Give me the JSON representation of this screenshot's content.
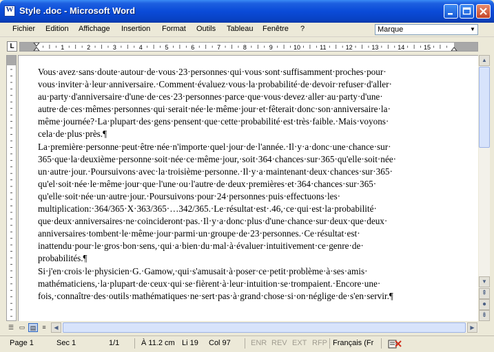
{
  "window": {
    "title": "Style .doc - Microsoft Word",
    "app_icon": "word-doc-icon"
  },
  "menu": [
    "Fichier",
    "Edition",
    "Affichage",
    "Insertion",
    "Format",
    "Outils",
    "Tableau",
    "Fenêtre",
    "?"
  ],
  "style_box": {
    "value": "Marque"
  },
  "ruler": {
    "tab_selector": "L",
    "numbers": [
      "1",
      "2",
      "3",
      "4",
      "5",
      "6",
      "7",
      "8",
      "9",
      "10",
      "11",
      "12",
      "13",
      "14",
      "15"
    ]
  },
  "document": {
    "paragraphs": [
      [
        "Vous·avez·sans·doute·autour·de·vous·23·personnes·qui·vous·sont·suffisamment·proches·pour·",
        "vous·inviter·à·leur·anniversaire.·Comment·évaluez·vous·la·probabilité·de·devoir·refuser·d'aller·",
        "au·party·d'anniversaire·d'une·de·ces·23·personnes·parce·que·vous·devez·aller·au·party·d'une·",
        "autre·de·ces·mêmes·personnes·qui·serait·née·le·même·jour·et·fêterait·donc·son·anniversaire·la·",
        "même·journée?·La·plupart·des·gens·pensent·que·cette·probabilité·est·très·faible.·Mais·voyons·",
        "cela·de·plus·près.¶"
      ],
      [
        "La·première·personne·peut·être·née·n'importe·quel·jour·de·l'année.·Il·y·a·donc·une·chance·sur·",
        "365·que·la·deuxième·personne·soit·née·ce·même·jour,·soit·364·chances·sur·365·qu'elle·soit·née·",
        "un·autre·jour.·Poursuivons·avec·la·troisième·personne.·Il·y·a·maintenant·deux·chances·sur·365·",
        "qu'el·soit·née·le·même·jour·que·l'une·ou·l'autre·de·deux·premières·et·364·chances·sur·365·",
        "qu'elle·soit·née·un·autre·jour.·Poursuivons·pour·24·personnes·puis·effectuons·les·",
        "multiplication:·364/365·X·363/365·…342/365.·Le·résultat·est·.46,·ce·qui·est·la·probabilité·",
        "que·deux·anniversaires·ne·coincideront·pas.·Il·y·a·donc·plus·d'une·chance·sur·deux·que·deux·",
        "anniversaires·tombent·le·même·jour·parmi·un·groupe·de·23·personnes.·Ce·résultat·est·",
        "inattendu·pour·le·gros·bon·sens,·qui·a·bien·du·mal·à·évaluer·intuitivement·ce·genre·de·",
        "probabilités.¶"
      ],
      [
        "Si·j'en·crois·le·physicien·G.·Gamow,·qui·s'amusait·à·poser·ce·petit·problème·à·ses·amis·",
        "mathématiciens,·la·plupart·de·ceux·qui·se·fièrent·à·leur·intuition·se·trompaient.·Encore·une·",
        "fois,·connaître·des·outils·mathématiques·ne·sert·pas·à·grand·chose·si·on·néglige·de·s'en·servir.¶"
      ]
    ]
  },
  "status": {
    "page": "Page 1",
    "section": "Sec 1",
    "pages": "1/1",
    "at": "À 11.2 cm",
    "line": "Li 19",
    "col": "Col 97",
    "modes": [
      "ENR",
      "REV",
      "EXT",
      "RFP"
    ],
    "language": "Français (Fr",
    "spell_icon": "spellcheck-book-icon"
  }
}
